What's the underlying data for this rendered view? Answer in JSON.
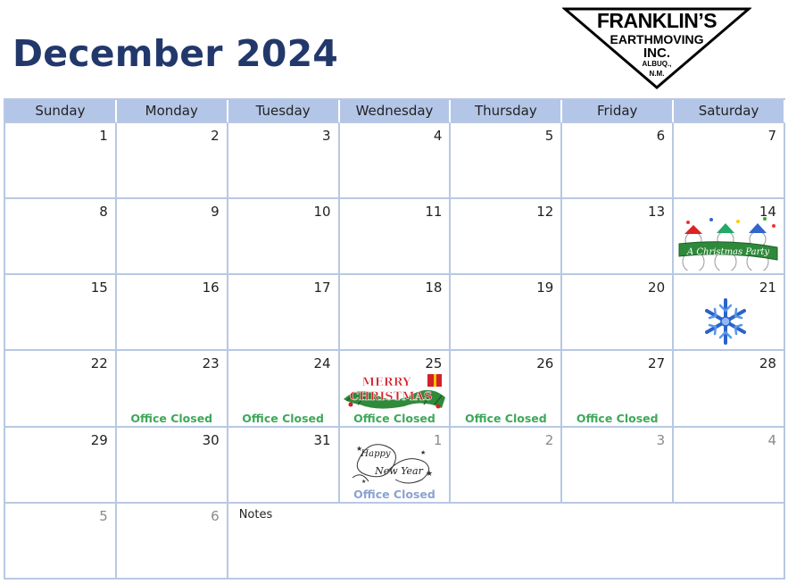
{
  "header": {
    "title": "December 2024",
    "logo": [
      "FRANKLIN’S",
      "EARTHMOVING",
      "INC.",
      "ALBUQ.,",
      "N.M."
    ]
  },
  "weekdays": [
    "Sunday",
    "Monday",
    "Tuesday",
    "Wednesday",
    "Thursday",
    "Friday",
    "Saturday"
  ],
  "days": [
    [
      "1",
      "2",
      "3",
      "4",
      "5",
      "6",
      "7"
    ],
    [
      "8",
      "9",
      "10",
      "11",
      "12",
      "13",
      "14"
    ],
    [
      "15",
      "16",
      "17",
      "18",
      "19",
      "20",
      "21"
    ],
    [
      "22",
      "23",
      "24",
      "25",
      "26",
      "27",
      "28"
    ],
    [
      "29",
      "30",
      "31",
      "1",
      "2",
      "3",
      "4"
    ],
    [
      "5",
      "6"
    ]
  ],
  "events": {
    "office_closed": "Office Closed",
    "party_banner": "A Christmas Party",
    "merry": "MERRY",
    "christmas": "CHRISTMAS",
    "happy": "Happy",
    "new_year": "New Year"
  },
  "notes_label": "Notes",
  "colors": {
    "title": "#22386b",
    "header_bg": "#b4c6e7",
    "grid": "#b8c8e2",
    "office_closed": "#3ea85b",
    "office_closed_light": "#8aa3cf"
  }
}
